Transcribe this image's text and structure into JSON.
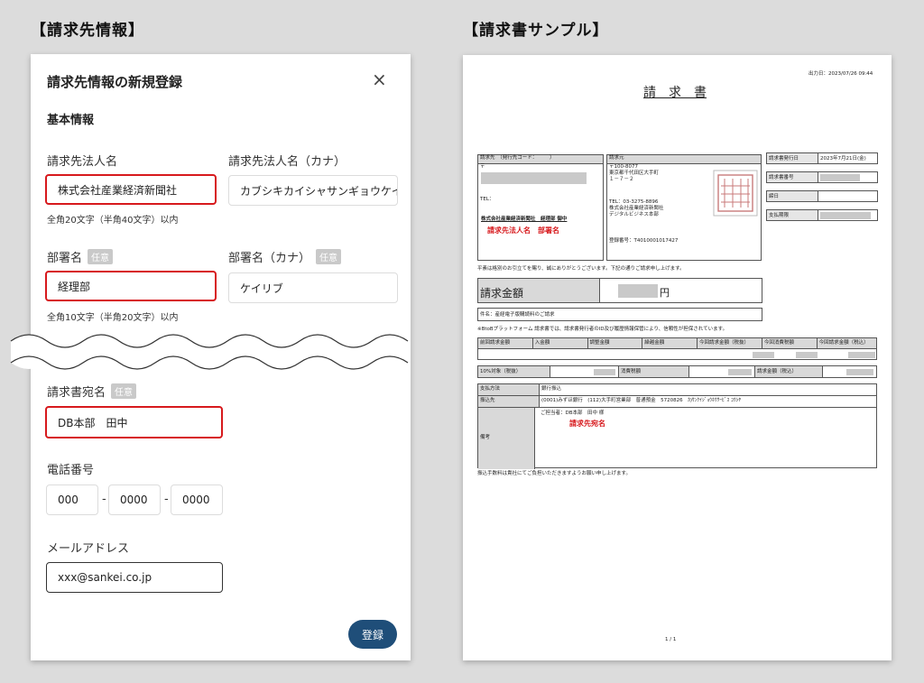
{
  "sections": {
    "left": "【請求先情報】",
    "right": "【請求書サンプル】"
  },
  "form": {
    "title": "請求先情報の新規登録",
    "close": "×",
    "section_basic": "基本情報",
    "company_label": "請求先法人名",
    "company_value": "株式会社産業経済新聞社",
    "company_kana_label": "請求先法人名（カナ）",
    "company_kana_value": "カブシキカイシャサンギョウケイ",
    "company_hint": "全角20文字（半角40文字）以内",
    "dept_label": "部署名",
    "dept_badge": "任意",
    "dept_value": "経理部",
    "dept_kana_label": "部署名（カナ）",
    "dept_kana_badge": "任意",
    "dept_kana_value": "ケイリブ",
    "dept_hint": "全角10文字（半角20文字）以内",
    "addressee_label": "請求書宛名",
    "addressee_badge": "任意",
    "addressee_value": "DB本部　田中",
    "phone_label": "電話番号",
    "phone": [
      "000",
      "0000",
      "0000"
    ],
    "phone_sep": "-",
    "email_label": "メールアドレス",
    "email_value": "xxx@sankei.co.jp",
    "submit": "登録"
  },
  "invoice": {
    "output_date": "出力日：2023/07/26 09:44",
    "title": "請　求　書",
    "billto_header": "請求先　（発行先コード：　　　）",
    "billto_postal": "〒",
    "billto_tel": "TEL：",
    "billto_company": "株式会社産業経済新聞社　経理部 御中",
    "billto_annotation": "請求先法人名　部署名",
    "issuer_header": "請求元",
    "issuer_postal": "〒100-8077",
    "issuer_address1": "東京都千代田区大手町",
    "issuer_address2": "１－７－２",
    "issuer_tel": "TEL：03-3275-8896",
    "issuer_company": "株式会社産業経済新聞社",
    "issuer_dept": "デジタルビジネス本部",
    "issuer_reg": "登録番号：T4010001017427",
    "info_labels": [
      "請求書発行日",
      "請求書番号",
      "締日",
      "支払期限"
    ],
    "issue_date": "2023年7月21日(金)",
    "greeting": "平素は格別のお引立てを賜り、誠にありがとうございます。下記の通りご請求申し上げます。",
    "amount_label": "請求金額",
    "amount_unit": "円",
    "subject": "件名：産経電子版購読料のご請求",
    "note": "※BtoBプラットフォーム 請求書では、請求書発行者のID及び履歴情報保管により、信頼性が担保されています。",
    "summary_headers": [
      "前回請求金額",
      "入金額",
      "調整金額",
      "繰越金額",
      "今回請求金額（税抜）",
      "今回消費税額",
      "今回請求金額（税込）"
    ],
    "tax_labels": [
      "10%対象（税抜）",
      "消費税額",
      "請求金額（税込）"
    ],
    "payment_method_label": "支払方法",
    "payment_method": "銀行振込",
    "bank_label": "振込先",
    "bank": "(0001)みずほ銀行　(112)大手町営業部　普通預金　5720826　ｶ)ｻﾝｹｲｼﾞｮｳﾎｳｻｰﾋﾞｽ ｺｳｼﾔ",
    "remarks_label": "備考",
    "remarks": "ご担当者：DB本部　田中 様",
    "remarks_annotation": "請求先宛名",
    "footer_note": "振込手数料は貴社にてご負担いただきますようお願い申し上げます。",
    "page": "1 / 1"
  }
}
